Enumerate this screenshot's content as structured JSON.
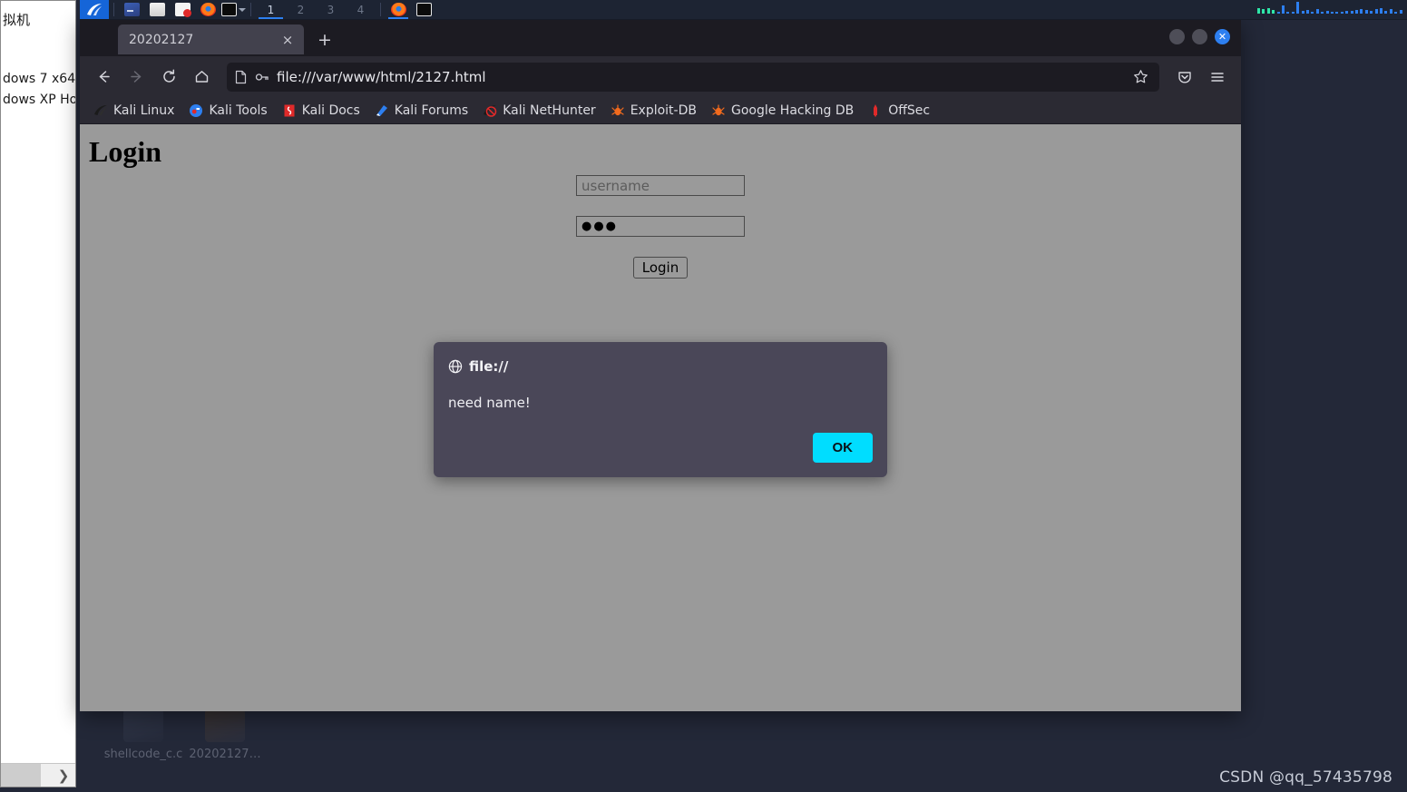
{
  "taskbar": {
    "kali_logo": "kali-dragon-logo",
    "launchers": [
      {
        "name": "terminal-icon",
        "cls": "ic-term"
      },
      {
        "name": "files-icon",
        "cls": "ic-files"
      },
      {
        "name": "text-editor-icon",
        "cls": "ic-doc"
      },
      {
        "name": "firefox-icon",
        "cls": "ic-ff"
      },
      {
        "name": "terminal-window-icon",
        "cls": "ic-black"
      }
    ],
    "workspaces": [
      "1",
      "2",
      "3",
      "4"
    ],
    "active_workspace": "1",
    "running": [
      {
        "name": "firefox-taskbar-icon",
        "cls": "ic-ff",
        "active": true
      },
      {
        "name": "terminal-taskbar-icon",
        "cls": "ic-black",
        "active": false
      }
    ]
  },
  "vm_manager": {
    "header": "拟机",
    "items": [
      "dows 7 x64",
      "dows XP Ho"
    ],
    "scroll_arrow": "❯"
  },
  "browser": {
    "tab": {
      "title": "20202127",
      "close_glyph": "×"
    },
    "new_tab_glyph": "+",
    "window_controls": {
      "minimize": "",
      "maximize": "",
      "close_glyph": "✕"
    },
    "nav": {
      "back": "←",
      "forward": "→",
      "reload": "⟳",
      "home": "⌂"
    },
    "url": "file:///var/www/html/2127.html",
    "url_page_icon": "document-icon",
    "url_lock_icon": "key-icon",
    "star_icon": "bookmark-star-icon",
    "pocket_icon": "pocket-icon",
    "menu_icon": "hamburger-menu-icon",
    "bookmarks": [
      {
        "label": "Kali Linux",
        "icon": "kali-dragon-bookmark-icon"
      },
      {
        "label": "Kali Tools",
        "icon": "kali-tools-icon"
      },
      {
        "label": "Kali Docs",
        "icon": "kali-docs-icon"
      },
      {
        "label": "Kali Forums",
        "icon": "kali-forums-icon"
      },
      {
        "label": "Kali NetHunter",
        "icon": "kali-nethunter-icon"
      },
      {
        "label": "Exploit-DB",
        "icon": "exploit-db-icon"
      },
      {
        "label": "Google Hacking DB",
        "icon": "google-hacking-db-icon"
      },
      {
        "label": "OffSec",
        "icon": "offsec-icon"
      }
    ]
  },
  "page": {
    "title": "Login",
    "username": {
      "value": "",
      "placeholder": "username"
    },
    "password": {
      "value": "●●●",
      "placeholder": ""
    },
    "login_label": "Login"
  },
  "dialog": {
    "origin_icon": "globe-icon",
    "origin": "file://",
    "message": "need name!",
    "ok_label": "OK",
    "ok_color": "#00ddff"
  },
  "desktop": {
    "icons": [
      {
        "label": "shellcode_c.c",
        "kind": "c-file"
      },
      {
        "label": "20202127…",
        "kind": "pic"
      }
    ],
    "watermark": "CSDN @qq_57435798",
    "background_color": "#232838"
  }
}
